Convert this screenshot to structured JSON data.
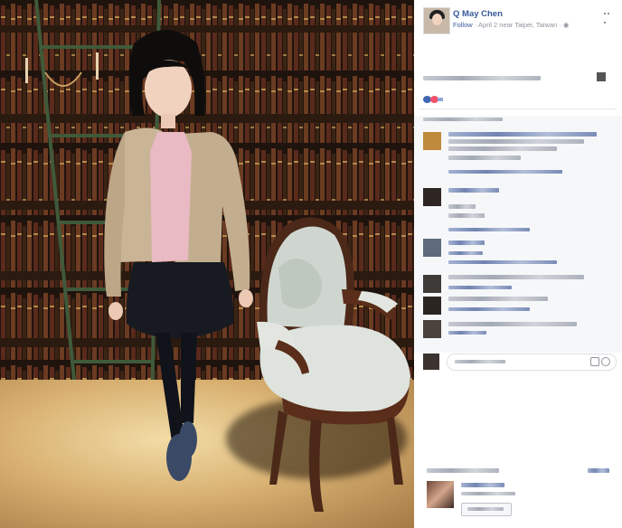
{
  "post": {
    "author": "Q May Chen",
    "follow": "Follow",
    "meta": " · April 2 near Taipei, Taiwan · ",
    "privacy_icon": "globe-icon"
  },
  "panel": {
    "options_icon": "more-options-icon",
    "comment_input_icons": [
      "camera-icon",
      "emoji-icon"
    ]
  },
  "colors": {
    "link": "#365899",
    "meta": "#90949c",
    "like": "#4267b2",
    "love": "#f25268",
    "comment_bg": "#f6f7f9"
  }
}
